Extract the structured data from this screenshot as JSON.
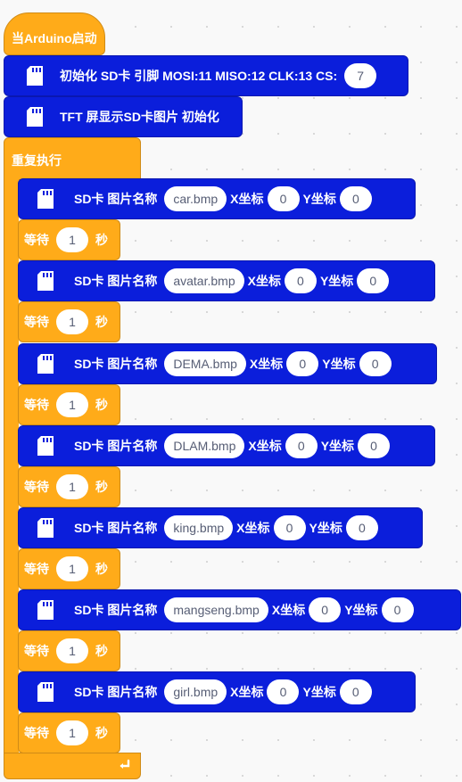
{
  "hat": {
    "label": "当Arduino启动"
  },
  "init_sd": {
    "label": "初始化 SD卡 引脚 MOSI:11 MISO:12 CLK:13 CS:",
    "cs": "7"
  },
  "init_tft": {
    "label": "TFT 屏显示SD卡图片 初始化"
  },
  "loop": {
    "label": "重复执行"
  },
  "labels": {
    "sd_name": "SD卡 图片名称",
    "x": "X坐标",
    "y": "Y坐标",
    "wait": "等待",
    "sec": "秒"
  },
  "images": [
    {
      "file": "car.bmp",
      "x": "0",
      "y": "0",
      "wait": "1"
    },
    {
      "file": "avatar.bmp",
      "x": "0",
      "y": "0",
      "wait": "1"
    },
    {
      "file": "DEMA.bmp",
      "x": "0",
      "y": "0",
      "wait": "1"
    },
    {
      "file": "DLAM.bmp",
      "x": "0",
      "y": "0",
      "wait": "1"
    },
    {
      "file": "king.bmp",
      "x": "0",
      "y": "0",
      "wait": "1"
    },
    {
      "file": "mangseng.bmp",
      "x": "0",
      "y": "0",
      "wait": "1"
    },
    {
      "file": "girl.bmp",
      "x": "0",
      "y": "0",
      "wait": "1"
    }
  ],
  "colors": {
    "event": "#ffab19",
    "control": "#ffab19",
    "sd_block": "#0b1edb"
  },
  "icons": {
    "sd": "sd-card-icon",
    "loop_arrow": "loop-arrow-icon"
  }
}
